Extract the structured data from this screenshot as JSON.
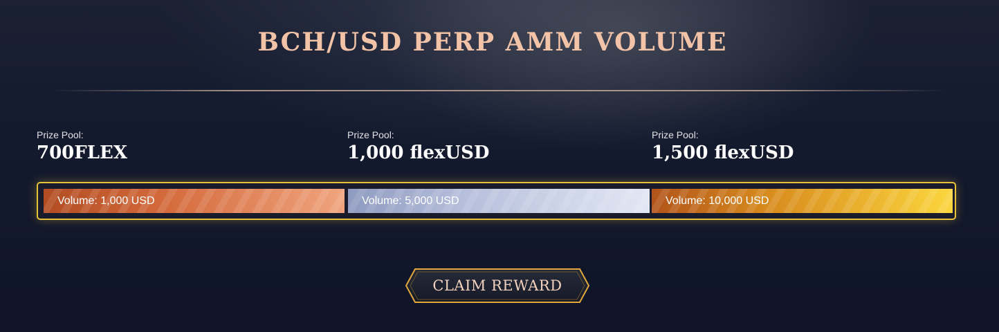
{
  "title": "BCH/USD PERP AMM VOLUME",
  "tiers": [
    {
      "prize_label": "Prize Pool:",
      "prize_value": "700FLEX",
      "volume_label": "Volume: 1,000 USD"
    },
    {
      "prize_label": "Prize Pool:",
      "prize_value": "1,000 flexUSD",
      "volume_label": "Volume: 5,000 USD"
    },
    {
      "prize_label": "Prize Pool:",
      "prize_value": "1,500 flexUSD",
      "volume_label": "Volume: 10,000 USD"
    }
  ],
  "claim_button": {
    "label": "CLAIM REWARD"
  },
  "colors": {
    "title": "#f3c3a8",
    "frame_border": "#e8c33a",
    "tier1": "#d46a3c",
    "tier2": "#b7c0dc",
    "tier3": "#fbd63e"
  }
}
